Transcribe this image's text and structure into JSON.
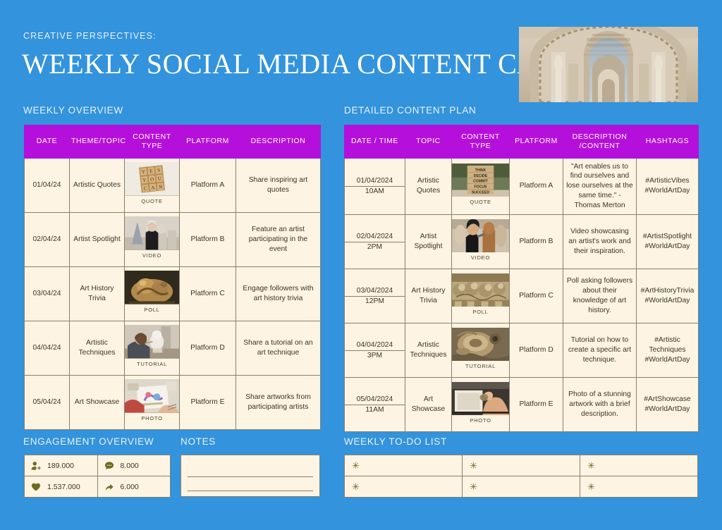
{
  "theme": {
    "background": "#3393DC",
    "header_accent": "#B510DB",
    "cell_background": "#FDF4E3",
    "cell_border": "#8C7F6A",
    "icon_color": "#6B6B21",
    "title_color": "#FFFFFF"
  },
  "header": {
    "eyebrow": "CREATIVE PERSPECTIVES:",
    "title": "WEEKLY SOCIAL MEDIA CONTENT CALENDAR",
    "title_star": "✳",
    "hero_image_alt": "classical-fresco-architecture-arches"
  },
  "sections": {
    "weekly_overview": "WEEKLY OVERVIEW",
    "detailed_plan": "DETAILED CONTENT PLAN",
    "engagement_overview": "ENGAGEMENT OVERVIEW",
    "notes": "NOTES",
    "weekly_todo": "WEEKLY TO-DO LIST"
  },
  "weekly_overview": {
    "columns": [
      "DATE",
      "THEME/TOPIC",
      "CONTENT TYPE",
      "PLATFORM",
      "DESCRIPTION"
    ],
    "rows": [
      {
        "date": "01/04/24",
        "theme": "Artistic Quotes",
        "content_type": "QUOTE",
        "thumb": "scrabble-tiles-yes-you-can",
        "platform": "Platform A",
        "description": "Share inspiring art quotes"
      },
      {
        "date": "02/04/24",
        "theme": "Artist Spotlight",
        "content_type": "VIDEO",
        "thumb": "artist-in-sculpture-studio",
        "platform": "Platform B",
        "description": "Feature an artist participating in the event"
      },
      {
        "date": "03/04/24",
        "theme": "Art History Trivia",
        "content_type": "POLL",
        "thumb": "carved-stone-sculpture-detail",
        "platform": "Platform C",
        "description": "Engage followers with art history trivia"
      },
      {
        "date": "04/04/24",
        "theme": "Artistic Techniques",
        "content_type": "TUTORIAL",
        "thumb": "artist-sculpting-plaster-bust",
        "platform": "Platform D",
        "description": "Share a tutorial on an art technique"
      },
      {
        "date": "05/04/24",
        "theme": "Art Showcase",
        "content_type": "PHOTO",
        "thumb": "hands-painting-watercolor",
        "platform": "Platform E",
        "description": "Share artworks from participating artists"
      }
    ]
  },
  "detailed_plan": {
    "columns": [
      "DATE / TIME",
      "TOPIC",
      "CONTENT TYPE",
      "PLATFORM",
      "DESCRIPTION /CONTENT",
      "HASHTAGS"
    ],
    "rows": [
      {
        "date": "01/04/2024",
        "time": "10AM",
        "topic": "Artistic Quotes",
        "content_type": "QUOTE",
        "thumb": "wood-blocks-think-decide-commit",
        "platform": "Platform A",
        "description": "\"Art enables us to find ourselves and lose ourselves at the same time.\" - Thomas Merton",
        "hashtags": "#ArtisticVibes #WorldArtDay"
      },
      {
        "date": "02/04/2024",
        "time": "2PM",
        "topic": "Artist Spotlight",
        "content_type": "VIDEO",
        "thumb": "sculptor-working-on-clay-figure",
        "platform": "Platform B",
        "description": "Video showcasing an artist's work and their inspiration.",
        "hashtags": "#ArtistSpotlight #WorldArtDay"
      },
      {
        "date": "03/04/2024",
        "time": "12PM",
        "topic": "Art History Trivia",
        "content_type": "POLL",
        "thumb": "ornate-carved-stone-relief",
        "platform": "Platform C",
        "description": "Poll asking followers about their knowledge of art history.",
        "hashtags": "#ArtHistoryTrivia #WorldArtDay"
      },
      {
        "date": "04/04/2024",
        "time": "3PM",
        "topic": "Artistic Techniques",
        "content_type": "TUTORIAL",
        "thumb": "pottery-wheel-clay-forms",
        "platform": "Platform D",
        "description": "Tutorial on how to create a specific art technique.",
        "hashtags": "#Artistic Techniques #WorldArtDay"
      },
      {
        "date": "05/04/2024",
        "time": "11AM",
        "topic": "Art Showcase",
        "content_type": "PHOTO",
        "thumb": "hand-holding-small-artifact-in-box",
        "platform": "Platform E",
        "description": "Photo of a stunning artwork with a brief description.",
        "hashtags": "#ArtShowcase #WorldArtDay"
      }
    ]
  },
  "engagement": {
    "stats": [
      {
        "icon": "followers-icon",
        "value": "189.000"
      },
      {
        "icon": "comment-icon",
        "value": "8.000"
      },
      {
        "icon": "heart-icon",
        "value": "1.537.000"
      },
      {
        "icon": "share-icon",
        "value": "6.000"
      }
    ]
  },
  "notes": {
    "lines": [
      "",
      ""
    ]
  },
  "todo": {
    "bullet": "✳",
    "items": [
      "",
      "",
      "",
      "",
      "",
      ""
    ]
  }
}
